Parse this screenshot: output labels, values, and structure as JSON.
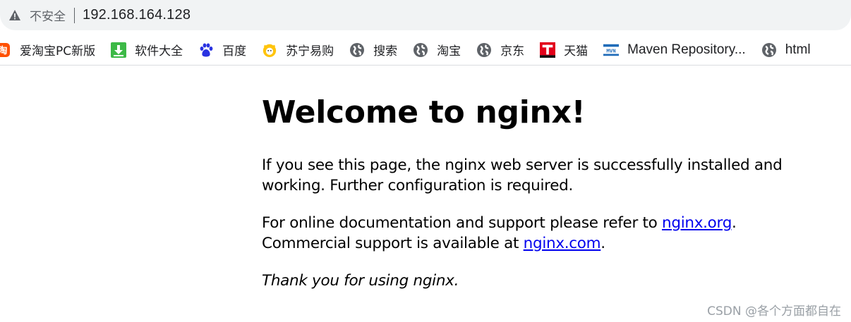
{
  "browser": {
    "security_label": "不安全",
    "url": "192.168.164.128",
    "bookmarks": [
      {
        "label": "爱淘宝PC新版",
        "icon": "taobao-icon"
      },
      {
        "label": "软件大全",
        "icon": "download-icon"
      },
      {
        "label": "百度",
        "icon": "baidu-paw-icon"
      },
      {
        "label": "苏宁易购",
        "icon": "suning-icon"
      },
      {
        "label": "搜索",
        "icon": "globe-icon"
      },
      {
        "label": "淘宝",
        "icon": "globe-icon"
      },
      {
        "label": "京东",
        "icon": "globe-icon"
      },
      {
        "label": "天猫",
        "icon": "tmall-icon"
      },
      {
        "label": "Maven Repository...",
        "icon": "mvn-icon"
      },
      {
        "label": "html",
        "icon": "globe-icon"
      }
    ]
  },
  "page": {
    "title": "Welcome to nginx!",
    "para1": "If you see this page, the nginx web server is successfully installed and working. Further configuration is required.",
    "para2_prefix": "For online documentation and support please refer to ",
    "link_org": "nginx.org",
    "para2_mid": ".",
    "para2_line2": "Commercial support is available at ",
    "link_com": "nginx.com",
    "para2_suffix": ".",
    "thanks": "Thank you for using nginx."
  },
  "watermark": "CSDN @各个方面都自在",
  "colors": {
    "link": "#0000ee",
    "chrome_bg": "#f1f3f4"
  }
}
